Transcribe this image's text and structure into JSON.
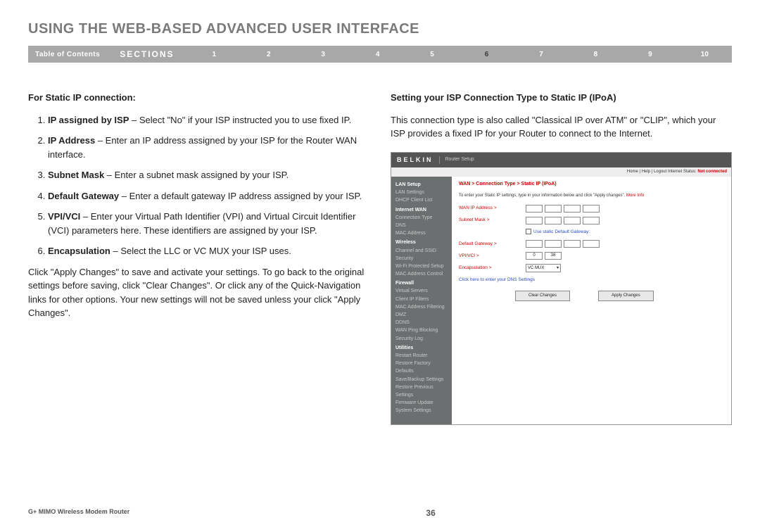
{
  "title": "USING THE WEB-BASED ADVANCED USER INTERFACE",
  "nav": {
    "toc": "Table of Contents",
    "sections": "SECTIONS",
    "nums": [
      "1",
      "2",
      "3",
      "4",
      "5",
      "6",
      "7",
      "8",
      "9",
      "10"
    ],
    "active": "6"
  },
  "left": {
    "heading": "For Static IP connection:",
    "items": [
      {
        "label": "IP assigned by ISP",
        "text": " – Select \"No\" if your ISP instructed you to use fixed IP."
      },
      {
        "label": "IP Address",
        "text": " – Enter an IP address assigned by your ISP for the Router WAN interface."
      },
      {
        "label": "Subnet Mask",
        "text": " – Enter a subnet mask assigned by your ISP."
      },
      {
        "label": "Default Gateway",
        "text": " – Enter a default gateway IP address assigned by your ISP."
      },
      {
        "label": "VPI/VCI",
        "text": " – Enter your Virtual Path Identifier (VPI) and Virtual Circuit Identifier (VCI) parameters here. These identifiers are assigned by your ISP."
      },
      {
        "label": "Encapsulation",
        "text": " – Select the LLC or VC MUX your ISP uses."
      }
    ],
    "para": "Click \"Apply Changes\" to save and activate your settings. To go back to the original settings before saving, click \"Clear Changes\". Or click any of the Quick-Navigation links for other options. Your new settings will not be saved unless your click \"Apply Changes\"."
  },
  "right": {
    "heading": "Setting your ISP Connection Type to Static IP (IPoA)",
    "para": "This connection type is also called \"Classical IP over ATM\" or \"CLIP\", which your ISP provides a fixed IP for your Router to connect to the Internet."
  },
  "shot": {
    "brand": "BELKIN",
    "routersetup": "Router Setup",
    "topbar_links": "Home | Help | Logout   Internet Status:",
    "topbar_status": "Not connected",
    "side": {
      "lan": "LAN Setup",
      "lan_items": [
        "LAN Settings",
        "DHCP Client List"
      ],
      "wan": "Internet WAN",
      "wan_items": [
        "Connection Type",
        "DNS",
        "MAC Address"
      ],
      "wireless": "Wireless",
      "wireless_items": [
        "Channel and SSID",
        "Security",
        "Wi-Fi Protected Setup",
        "MAC Address Control"
      ],
      "firewall": "Firewall",
      "firewall_items": [
        "Virtual Servers",
        "Client IP Filters",
        "MAC Address Filtering",
        "DMZ",
        "DDNS",
        "WAN Ping Blocking",
        "Security Log"
      ],
      "utilities": "Utilities",
      "utilities_items": [
        "Restart Router",
        "Restore Factory Defaults",
        "Save/Backup Settings",
        "Restore Previous Settings",
        "Firmware Update",
        "System Settings"
      ]
    },
    "main": {
      "breadcrumb": "WAN > Connection Type > Static IP (IPoA)",
      "instr": "To enter your Static IP settings, type in your information below and click \"Apply changes\".",
      "more": "More Info",
      "rows": {
        "wanip": "WAN IP Address >",
        "subnet": "Subnet Mask >",
        "usestatic": "Use static Default Gateway:",
        "gateway": "Default Gateway >",
        "vpivci": "VPI/VCI >",
        "vpi_val": "0",
        "vci_val": "38",
        "encaps": "Encapsulation >",
        "encaps_val": "VC MUX"
      },
      "dns_link": "Click here to enter your DNS Settings",
      "btn_clear": "Clear Changes",
      "btn_apply": "Apply Changes"
    }
  },
  "footer": {
    "product": "G+ MIMO Wireless Modem Router",
    "page": "36"
  }
}
